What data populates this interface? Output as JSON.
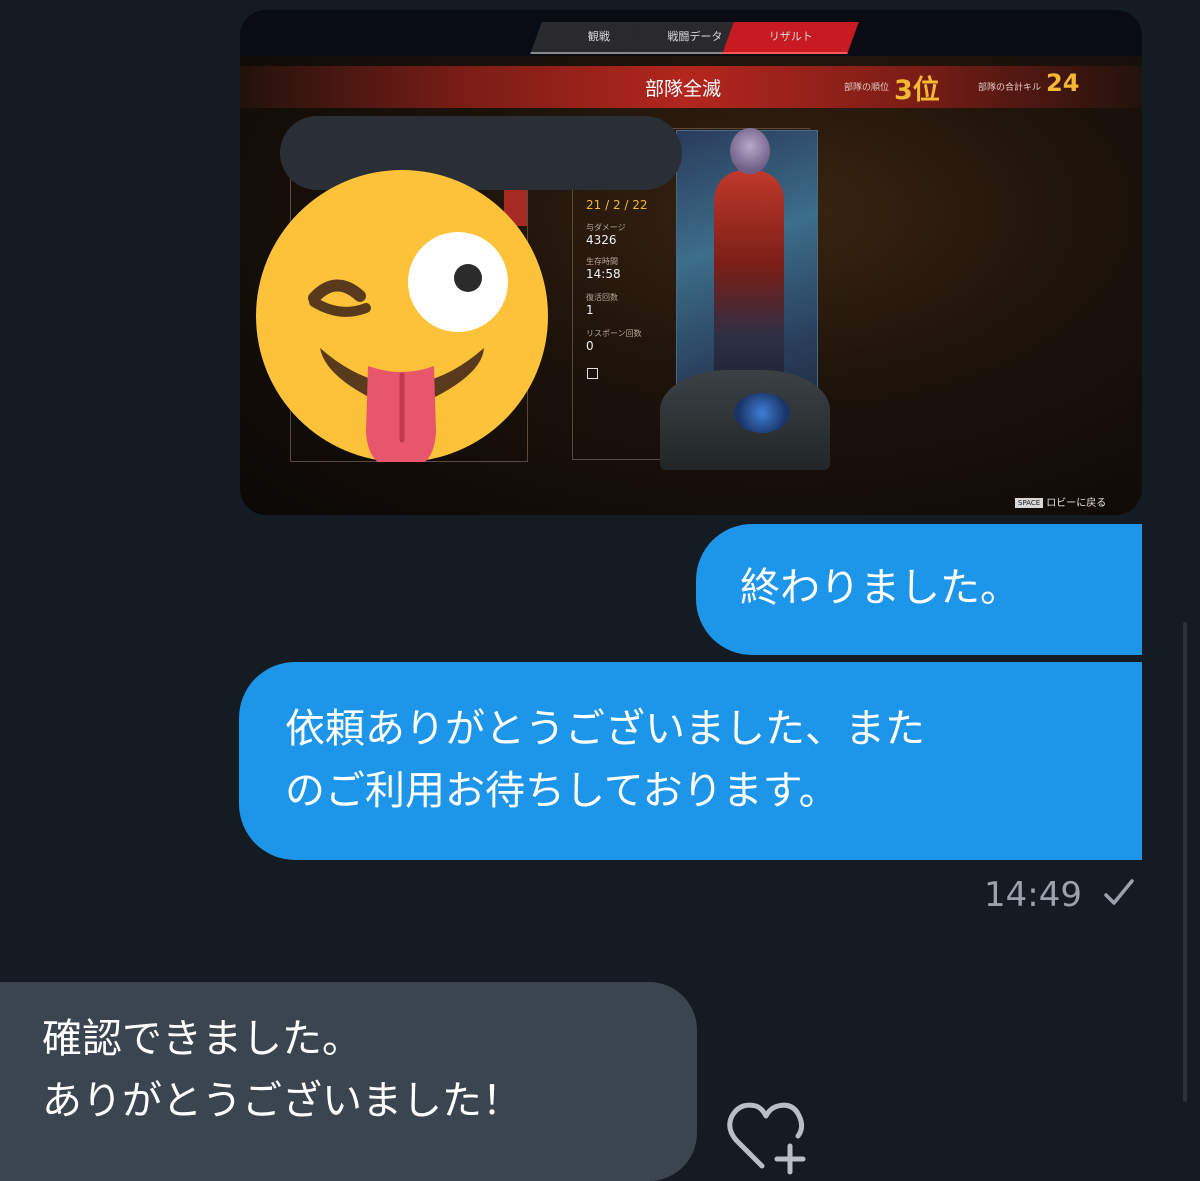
{
  "image_message": {
    "game_tabs": [
      "観戦",
      "戦闘データ",
      "リザルト"
    ],
    "banner_title": "部隊全滅",
    "squad_rank_label": "部隊の順位",
    "squad_rank_value": "3位",
    "squad_kills_label": "部隊の合計キル",
    "squad_kills_value": "24",
    "stats": {
      "kda": "21 / 2 / 22",
      "damage_label": "与ダメージ",
      "damage_value": "4326",
      "survival_label": "生存時間",
      "survival_value": "14:58",
      "revive_label": "復活回数",
      "revive_value": "1",
      "respawn_label": "リスポーン回数",
      "respawn_value": "0"
    },
    "footer_key": "SPACE",
    "footer_text": "ロビーに戻る",
    "overlay_emoji": "winking-face-with-tongue"
  },
  "messages": {
    "sent_1": "終わりました。",
    "sent_2_line1": "依頼ありがとうございました、また",
    "sent_2_line2": "のご利用お待ちしております。",
    "sent_time": "14:49",
    "received_1_line1": "確認できました。",
    "received_1_line2": "ありがとうございました！"
  },
  "colors": {
    "background": "#151b23",
    "sent_bubble": "#1d95e9",
    "received_bubble": "#3a4550",
    "accent_red": "#c81b21",
    "accent_gold": "#f5b833"
  }
}
